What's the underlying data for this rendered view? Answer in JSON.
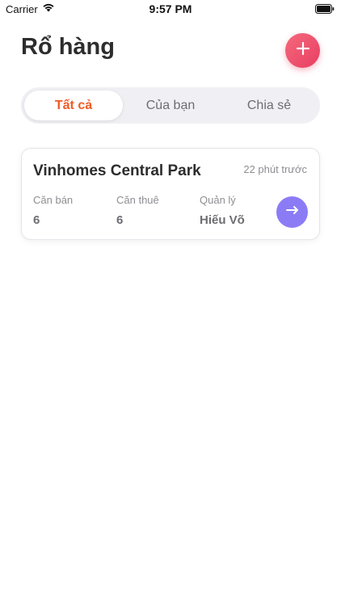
{
  "status_bar": {
    "carrier": "Carrier",
    "time": "9:57 PM"
  },
  "header": {
    "title": "Rổ hàng",
    "add_icon": "plus-icon",
    "accent_color": "#e83e62"
  },
  "tabs": [
    {
      "label": "Tất cả",
      "active": true
    },
    {
      "label": "Của bạn",
      "active": false
    },
    {
      "label": "Chia sẻ",
      "active": false
    }
  ],
  "cards": [
    {
      "title": "Vinhomes Central Park",
      "time": "22 phút trước",
      "stats": [
        {
          "label": "Căn bán",
          "value": "6"
        },
        {
          "label": "Căn thuê",
          "value": "6"
        },
        {
          "label": "Quản lý",
          "value": "Hiếu Võ"
        }
      ],
      "action_icon": "arrow-right-icon",
      "action_color": "#8b7cf6"
    }
  ]
}
